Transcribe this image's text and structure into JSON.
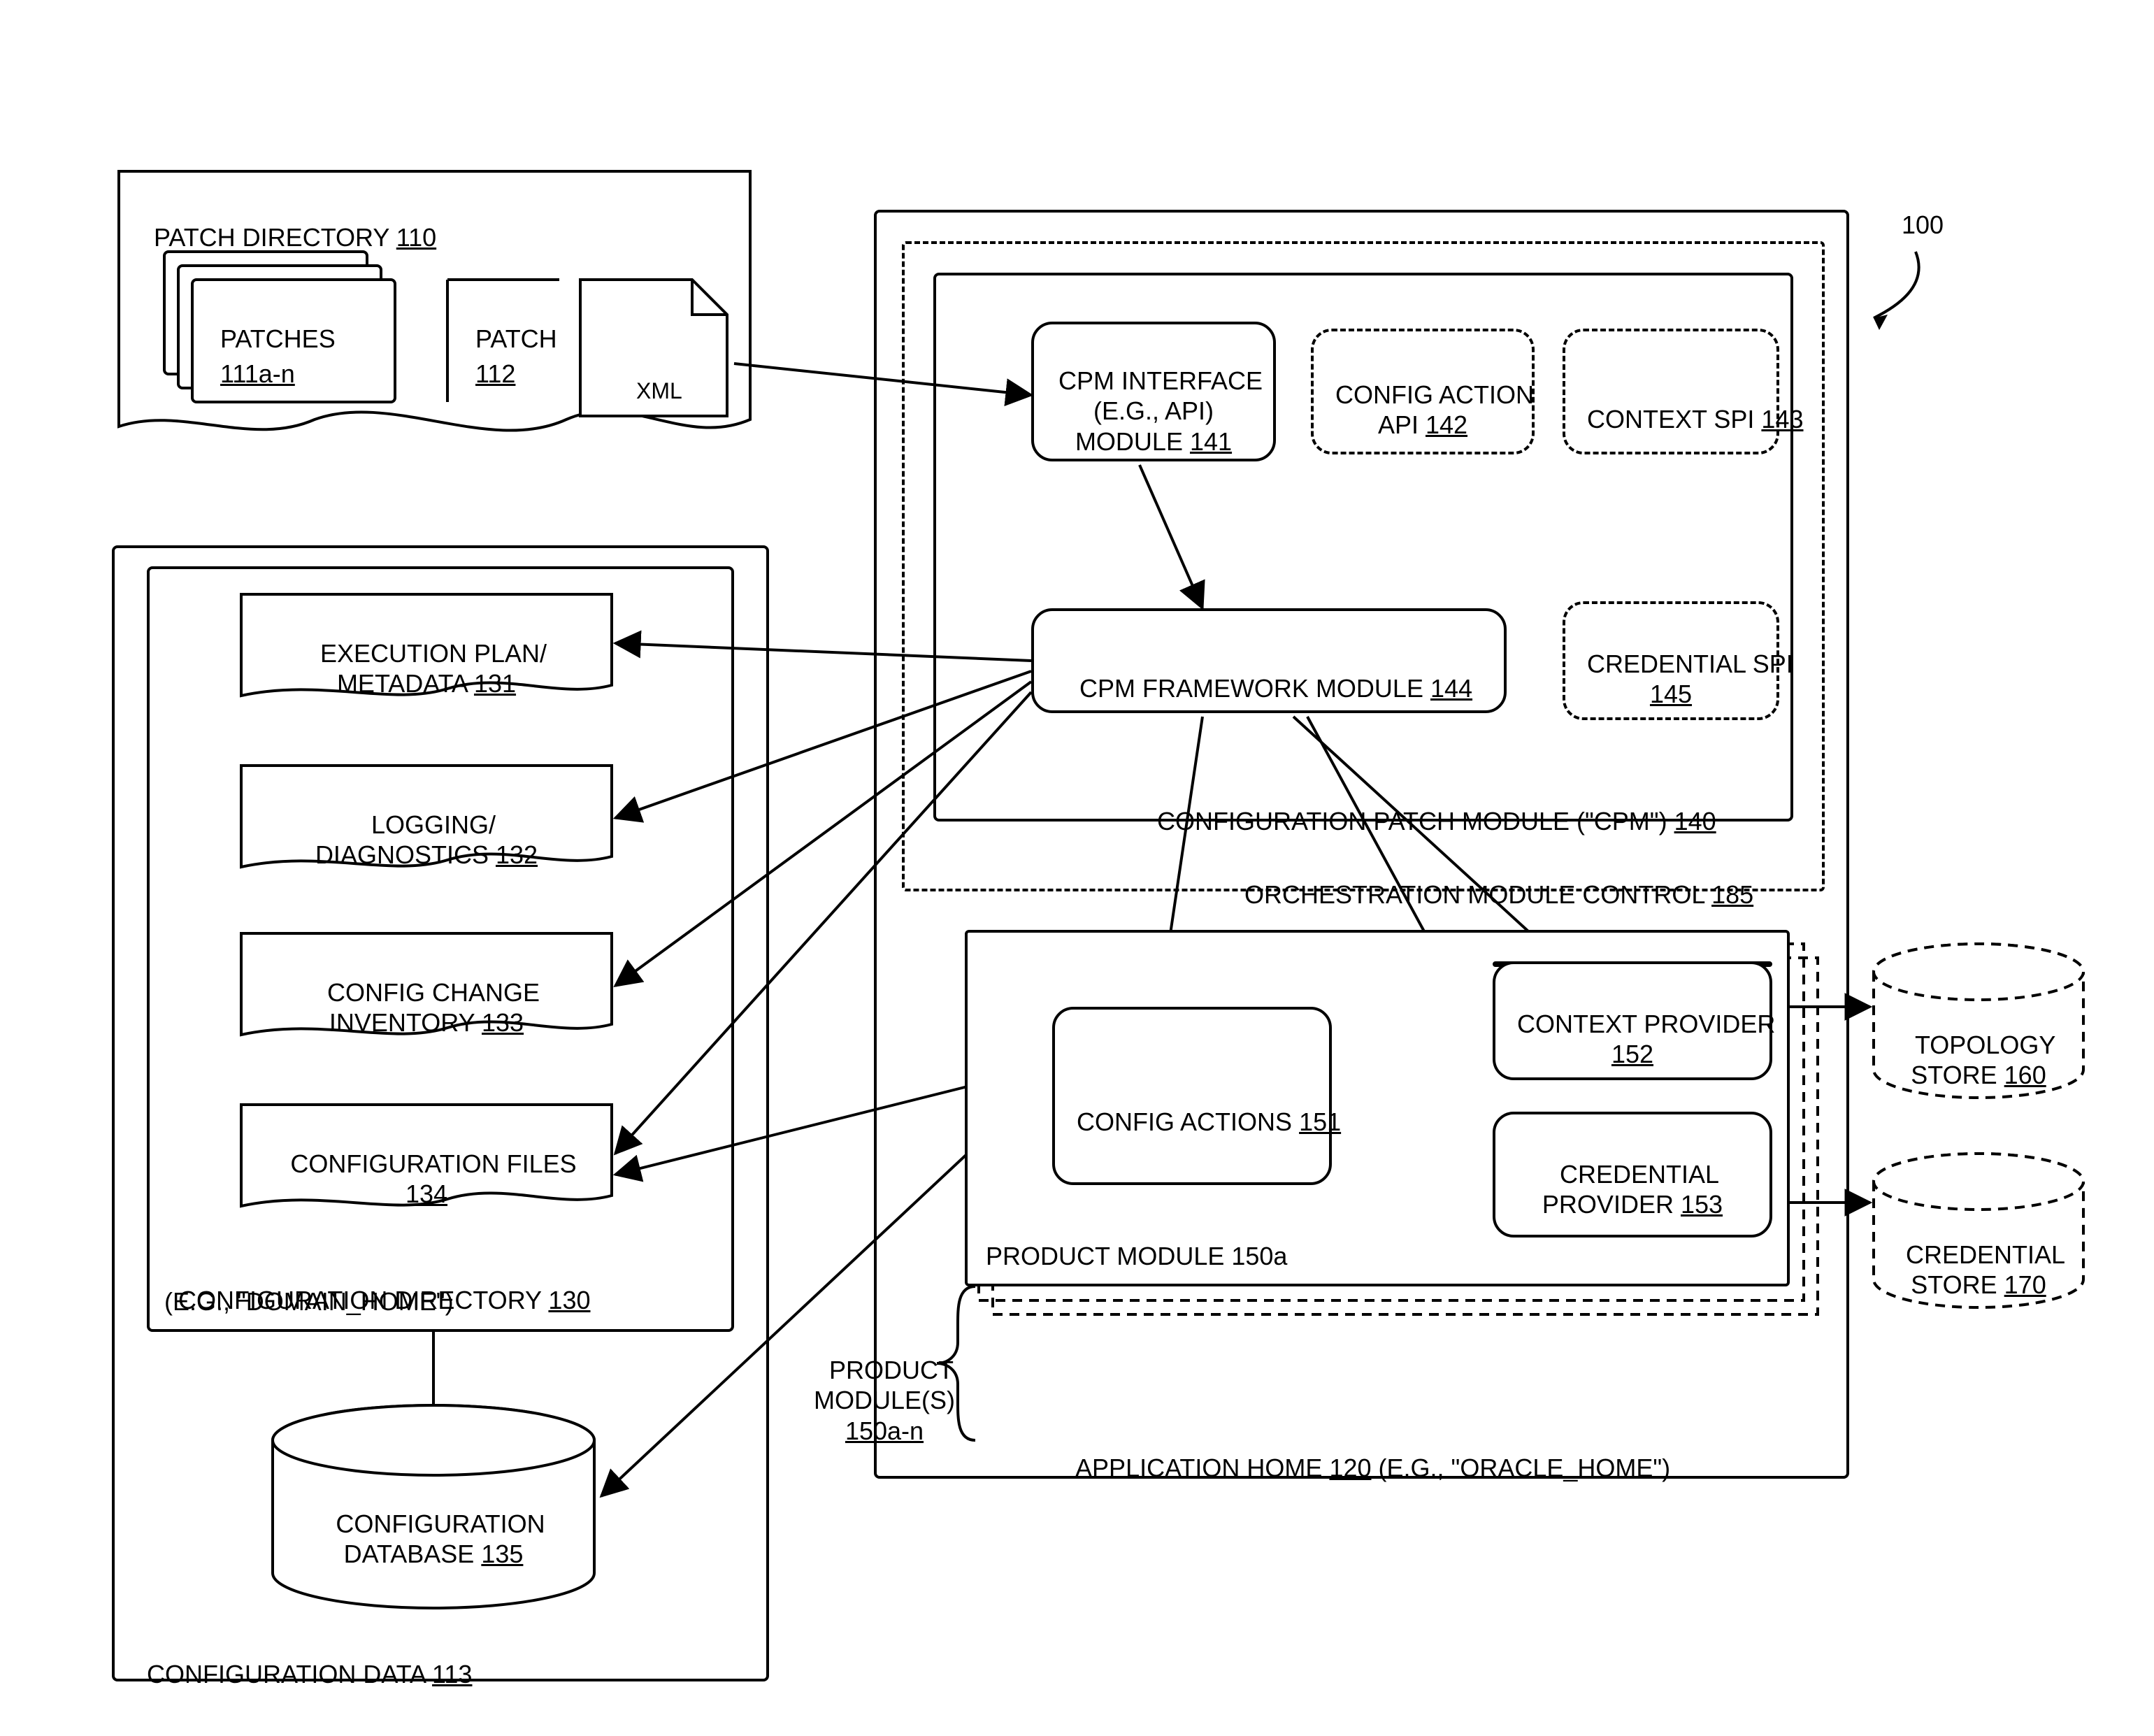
{
  "figure_ref": "100",
  "patch_directory": {
    "title": "PATCH DIRECTORY",
    "ref": "110",
    "patches_label": "PATCHES",
    "patches_ref": "111a-n",
    "patch_label": "PATCH",
    "patch_ref": "112",
    "patch_doc_type": "XML"
  },
  "configuration_data": {
    "title": "CONFIGURATION DATA",
    "ref": "113",
    "config_dir_label": "CONFIGURATION DIRECTORY",
    "config_dir_ref": "130",
    "config_dir_sub": "(E.G., \"DOMAIN_HOME\")",
    "items": [
      {
        "label": "EXECUTION PLAN/\nMETADATA",
        "ref": "131"
      },
      {
        "label": "LOGGING/\nDIAGNOSTICS",
        "ref": "132"
      },
      {
        "label": "CONFIG CHANGE\nINVENTORY",
        "ref": "133"
      },
      {
        "label": "CONFIGURATION FILES",
        "ref": "134"
      }
    ],
    "db_label": "CONFIGURATION\nDATABASE",
    "db_ref": "135"
  },
  "application_home": {
    "title_prefix": "APPLICATION HOME",
    "ref": "120",
    "title_suffix": "(E.G., \"ORACLE_HOME\")",
    "orchestration_label": "ORCHESTRATION MODULE CONTROL",
    "orchestration_ref": "185",
    "cpm": {
      "caption_prefix": "CONFIGURATION PATCH MODULE (\"CPM\")",
      "ref": "140",
      "interface_label": "CPM INTERFACE\n(E.G., API)\nMODULE",
      "interface_ref": "141",
      "config_action_api_label": "CONFIG ACTION\nAPI",
      "config_action_api_ref": "142",
      "context_spi_label": "CONTEXT SPI",
      "context_spi_ref": "143",
      "framework_label": "CPM FRAMEWORK MODULE",
      "framework_ref": "144",
      "credential_spi_label": "CREDENTIAL SPI",
      "credential_spi_ref": "145"
    },
    "product_module": {
      "label": "PRODUCT MODULE 150a",
      "brace_label": "PRODUCT\nMODULE(S)",
      "brace_ref": "150a-n",
      "config_actions_label": "CONFIG ACTIONS",
      "config_actions_ref": "151",
      "context_provider_label": "CONTEXT PROVIDER",
      "context_provider_ref": "152",
      "credential_provider_label": "CREDENTIAL\nPROVIDER",
      "credential_provider_ref": "153"
    }
  },
  "stores": {
    "topology_label": "TOPOLOGY\nSTORE",
    "topology_ref": "160",
    "credential_label": "CREDENTIAL\nSTORE",
    "credential_ref": "170"
  }
}
